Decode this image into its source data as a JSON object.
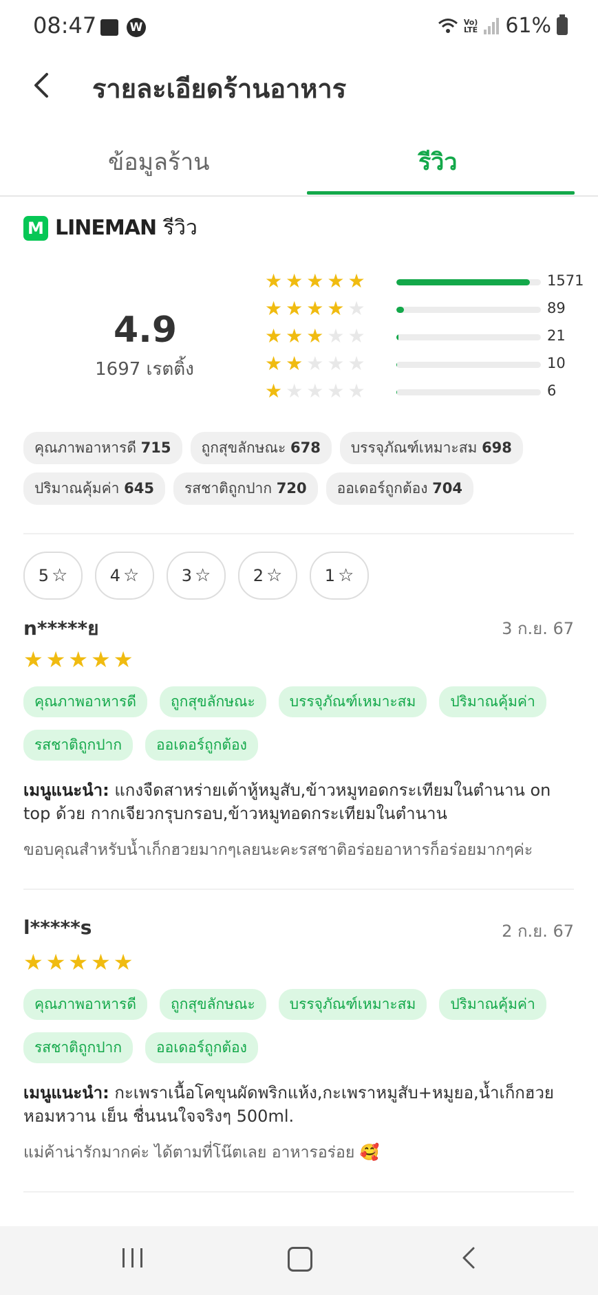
{
  "status_bar": {
    "time": "08:47",
    "notif_icon_letter": "W",
    "lte_top": "Vo)",
    "lte_bottom": "LTE",
    "battery": "61%"
  },
  "header": {
    "title": "รายละเอียดร้านอาหาร"
  },
  "tabs": [
    {
      "label": "ข้อมูลร้าน"
    },
    {
      "label": "รีวิว"
    }
  ],
  "brand": {
    "logo_letter": "M",
    "name": "LINEMAN",
    "suffix": "รีวิว"
  },
  "rating": {
    "average": "4.9",
    "total": "1697 เรตติ้ง",
    "distribution": [
      {
        "stars": 5,
        "count": "1571",
        "fraction": 0.925
      },
      {
        "stars": 4,
        "count": "89",
        "fraction": 0.052
      },
      {
        "stars": 3,
        "count": "21",
        "fraction": 0.012
      },
      {
        "stars": 2,
        "count": "10",
        "fraction": 0.006
      },
      {
        "stars": 1,
        "count": "6",
        "fraction": 0.004
      }
    ]
  },
  "attributes": [
    {
      "label": "คุณภาพอาหารดี",
      "count": "715"
    },
    {
      "label": "ถูกสุขลักษณะ",
      "count": "678"
    },
    {
      "label": "บรรจุภัณฑ์เหมาะสม",
      "count": "698"
    },
    {
      "label": "ปริมาณคุ้มค่า",
      "count": "645"
    },
    {
      "label": "รสชาติถูกปาก",
      "count": "720"
    },
    {
      "label": "ออเดอร์ถูกต้อง",
      "count": "704"
    }
  ],
  "filters": [
    {
      "label": "5"
    },
    {
      "label": "4"
    },
    {
      "label": "3"
    },
    {
      "label": "2"
    },
    {
      "label": "1"
    }
  ],
  "reviews": [
    {
      "user": "n*****ย",
      "date": "3 ก.ย. 67",
      "stars": "★★★★★",
      "tags": [
        "คุณภาพอาหารดี",
        "ถูกสุขลักษณะ",
        "บรรจุภัณฑ์เหมาะสม",
        "ปริมาณคุ้มค่า",
        "รสชาติถูกปาก",
        "ออเดอร์ถูกต้อง"
      ],
      "menu_label": "เมนูแนะนำ:",
      "menu": "แกงจืดสาหร่ายเต้าหู้หมูสับ,ข้าวหมูทอดกระเทียมในตำนาน on top ด้วย กากเจียวกรุบกรอบ,ข้าวหมูทอดกระเทียมในตำนาน",
      "comment": "ขอบคุณสำหรับน้ำเก็กฮวยมากๆเลยนะคะรสชาติอร่อยอาหารก็อร่อยมากๆค่ะ"
    },
    {
      "user": "l*****s",
      "date": "2 ก.ย. 67",
      "stars": "★★★★★",
      "tags": [
        "คุณภาพอาหารดี",
        "ถูกสุขลักษณะ",
        "บรรจุภัณฑ์เหมาะสม",
        "ปริมาณคุ้มค่า",
        "รสชาติถูกปาก",
        "ออเดอร์ถูกต้อง"
      ],
      "menu_label": "เมนูแนะนำ:",
      "menu": "กะเพราเนื้อโคขุนผัดพริกแห้ง,กะเพราหมูสับ+หมูยอ,น้ำเก็กฮวย หอมหวาน เย็น ชื่นนนใจจริงๆ 500ml.",
      "comment": "แม่ค้าน่ารักมากค่ะ ได้ตามที่โน๊ตเลย อาหารอร่อย 🥰"
    }
  ],
  "colors": {
    "accent": "#13a84a",
    "star": "#f0bb10",
    "tag_bg": "#dcf7e3"
  }
}
